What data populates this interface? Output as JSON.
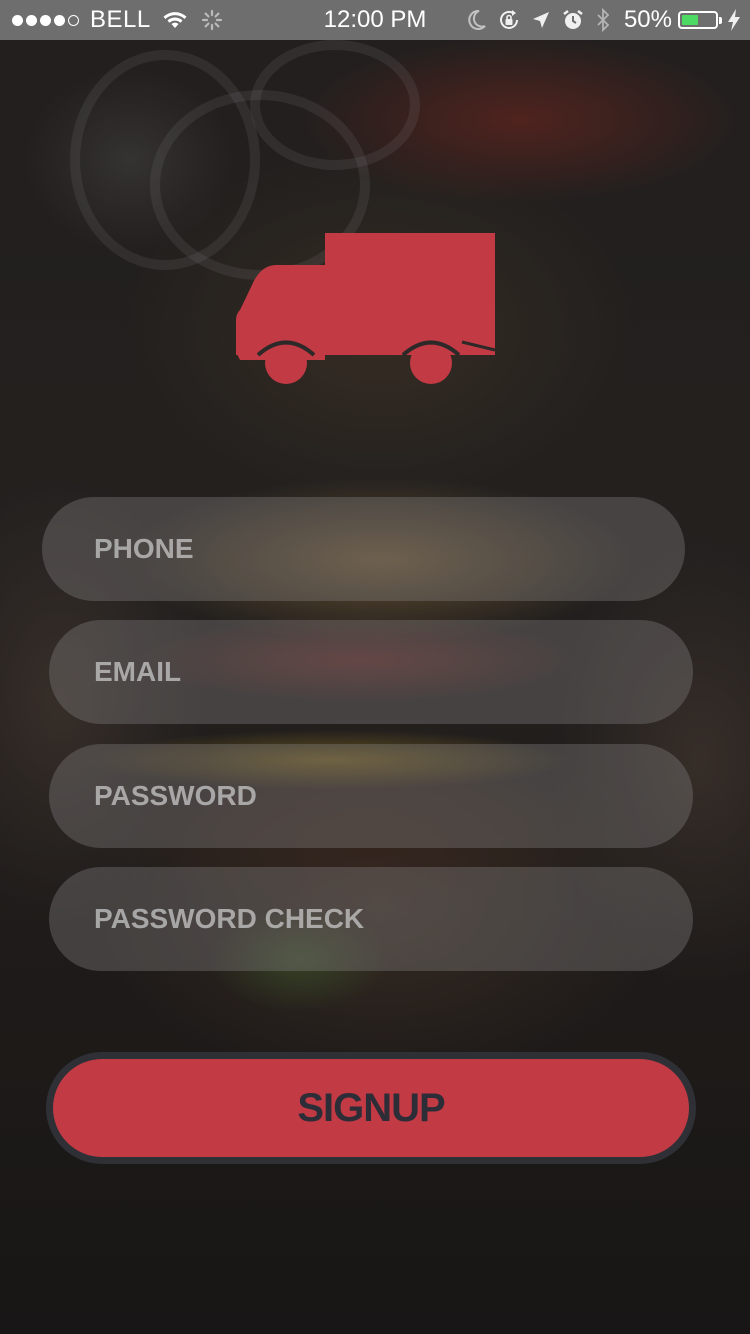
{
  "status_bar": {
    "carrier": "BELL",
    "time": "12:00 PM",
    "battery_percent_label": "50%",
    "battery_level": 0.5,
    "battery_color": "#4cd964",
    "icons": [
      "signal-dots-icon",
      "wifi-icon",
      "activity-spinner-icon",
      "moon-icon",
      "rotation-lock-icon",
      "location-arrow-icon",
      "alarm-icon",
      "bluetooth-icon",
      "battery-icon",
      "charging-bolt-icon"
    ]
  },
  "logo": {
    "icon": "delivery-truck-icon",
    "color": "#c23a44"
  },
  "form": {
    "phone_placeholder": "PHONE",
    "email_placeholder": "EMAIL",
    "password_placeholder": "PASSWORD",
    "password_check_placeholder": "PASSWORD CHECK"
  },
  "signup": {
    "label": "SIGNUP",
    "color": "#c23a44"
  }
}
